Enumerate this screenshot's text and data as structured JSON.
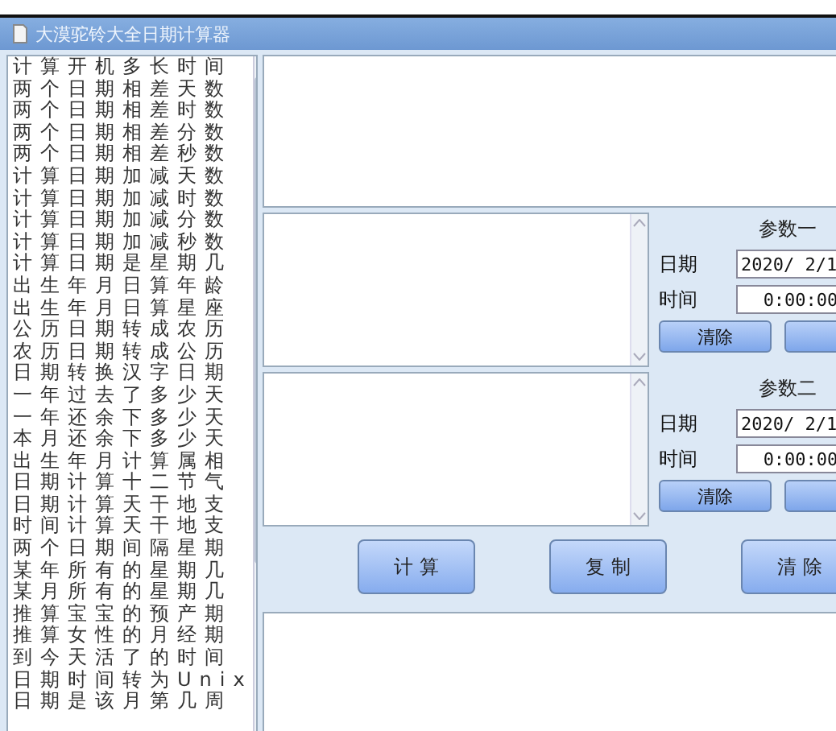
{
  "window": {
    "title": "大漠驼铃大全日期计算器"
  },
  "functions": [
    {
      "label": "计算开机多长时间",
      "selected": false
    },
    {
      "label": "两个日期相差天数",
      "selected": false
    },
    {
      "label": "两个日期相差时数",
      "selected": false
    },
    {
      "label": "两个日期相差分数",
      "selected": false
    },
    {
      "label": "两个日期相差秒数",
      "selected": false
    },
    {
      "label": "计算日期加减天数",
      "selected": false
    },
    {
      "label": "计算日期加减时数",
      "selected": false
    },
    {
      "label": "计算日期加减分数",
      "selected": false
    },
    {
      "label": "计算日期加减秒数",
      "selected": false
    },
    {
      "label": "计算日期是星期几",
      "selected": false
    },
    {
      "label": "出生年月日算年龄",
      "selected": false
    },
    {
      "label": "出生年月日算星座",
      "selected": false
    },
    {
      "label": "公历日期转成农历",
      "selected": false
    },
    {
      "label": "农历日期转成公历",
      "selected": false
    },
    {
      "label": "日期转换汉字日期",
      "selected": false
    },
    {
      "label": "一年过去了多少天",
      "selected": false
    },
    {
      "label": "一年还余下多少天",
      "selected": false
    },
    {
      "label": "本月还余下多少天",
      "selected": false
    },
    {
      "label": "出生年月计算属相",
      "selected": false
    },
    {
      "label": "日期计算十二节气",
      "selected": false
    },
    {
      "label": "日期计算天干地支",
      "selected": false
    },
    {
      "label": "时间计算天干地支",
      "selected": false
    },
    {
      "label": "两个日期间隔星期",
      "selected": false
    },
    {
      "label": "某年所有的星期几",
      "selected": false
    },
    {
      "label": "某月所有的星期几",
      "selected": false
    },
    {
      "label": "推算宝宝的预产期",
      "selected": false
    },
    {
      "label": "推算女性的月经期",
      "selected": false
    },
    {
      "label": "到今天活了的时间",
      "selected": false
    },
    {
      "label": "日期时间转为Unix",
      "selected": false
    },
    {
      "label": "日期是该月第几周",
      "selected": false
    }
  ],
  "params": [
    {
      "title": "参数一",
      "date_label": "日期",
      "date": "2020/ 2/1",
      "time_label": "时间",
      "time": "0:00:00",
      "clear": "清除"
    },
    {
      "title": "参数二",
      "date_label": "日期",
      "date": "2020/ 2/1",
      "time_label": "时间",
      "time": "0:00:00",
      "clear": "清除"
    }
  ],
  "actions": [
    "计 算",
    "复 制",
    "清 除"
  ]
}
